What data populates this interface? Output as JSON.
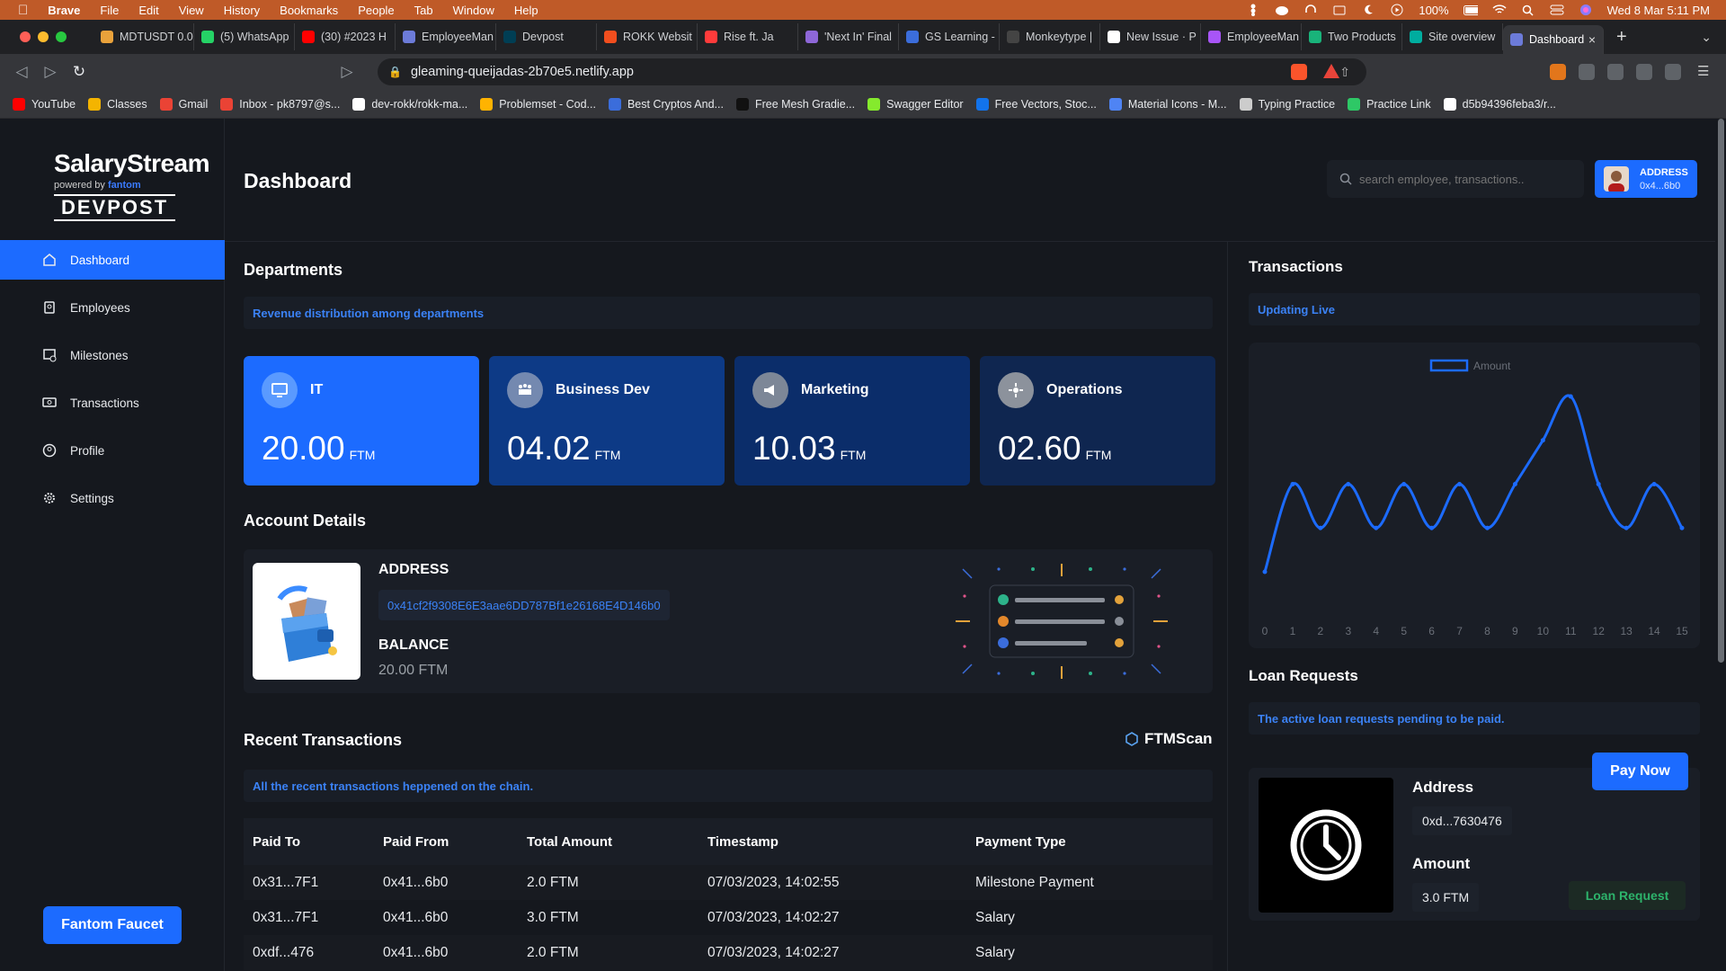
{
  "menubar": {
    "app": "Brave",
    "items": [
      "File",
      "Edit",
      "View",
      "History",
      "Bookmarks",
      "People",
      "Tab",
      "Window",
      "Help"
    ],
    "battery": "100%",
    "datetime": "Wed 8 Mar  5:11 PM"
  },
  "tabs": [
    {
      "label": "MDTUSDT 0.0",
      "color": "#e9a23b"
    },
    {
      "label": "(5) WhatsApp",
      "color": "#25d366"
    },
    {
      "label": "(30) #2023 H",
      "color": "#ff0000"
    },
    {
      "label": "EmployeeMan",
      "color": "#6c7bd9"
    },
    {
      "label": "Devpost",
      "color": "#003e54"
    },
    {
      "label": "ROKK Websit",
      "color": "#f24e1e"
    },
    {
      "label": "Rise ft. Ja",
      "color": "#ff3b3b"
    },
    {
      "label": "'Next In' Final",
      "color": "#8e67d8"
    },
    {
      "label": "GS Learning -",
      "color": "#3b6ddb"
    },
    {
      "label": "Monkeytype |",
      "color": "#444444"
    },
    {
      "label": "New Issue · P",
      "color": "#ffffff"
    },
    {
      "label": "EmployeeMan",
      "color": "#a855f7"
    },
    {
      "label": "Two Products",
      "color": "#19b37a"
    },
    {
      "label": "Site overview",
      "color": "#00ad9f"
    },
    {
      "label": "Dashboard",
      "color": "#6c7bd9",
      "active": true
    }
  ],
  "address_bar": {
    "url": "gleaming-queijadas-2b70e5.netlify.app"
  },
  "bookmarks": [
    {
      "label": "YouTube",
      "color": "#ff0000"
    },
    {
      "label": "Classes",
      "color": "#f4b400"
    },
    {
      "label": "Gmail",
      "color": "#ea4335"
    },
    {
      "label": "Inbox - pk8797@s...",
      "color": "#ea4335"
    },
    {
      "label": "dev-rokk/rokk-ma...",
      "color": "#ffffff"
    },
    {
      "label": "Problemset - Cod...",
      "color": "#ffb300"
    },
    {
      "label": "Best Cryptos And...",
      "color": "#3b6ddb"
    },
    {
      "label": "Free Mesh Gradie...",
      "color": "#111111"
    },
    {
      "label": "Swagger Editor",
      "color": "#85ea2d"
    },
    {
      "label": "Free Vectors, Stoc...",
      "color": "#1273eb"
    },
    {
      "label": "Material Icons - M...",
      "color": "#4f84f4"
    },
    {
      "label": "Typing Practice",
      "color": "#cccccc"
    },
    {
      "label": "Practice Link",
      "color": "#2ec866"
    },
    {
      "label": "d5b94396feba3/r...",
      "color": "#ffffff"
    }
  ],
  "brand": {
    "name": "SalaryStream",
    "powered": "powered by",
    "partner": "fantom",
    "sponsor": "DEVPOST"
  },
  "sidebar": {
    "items": [
      {
        "label": "Dashboard",
        "icon": "home-icon",
        "active": true
      },
      {
        "label": "Employees",
        "icon": "employees-icon"
      },
      {
        "label": "Milestones",
        "icon": "milestones-icon"
      },
      {
        "label": "Transactions",
        "icon": "transactions-icon"
      },
      {
        "label": "Profile",
        "icon": "profile-icon"
      },
      {
        "label": "Settings",
        "icon": "settings-icon"
      }
    ],
    "faucet_label": "Fantom Faucet"
  },
  "header": {
    "title": "Dashboard",
    "search_placeholder": "search employee, transactions..",
    "address_label": "ADDRESS",
    "address_short": "0x4...6b0"
  },
  "departments": {
    "title": "Departments",
    "subtitle": "Revenue distribution among departments",
    "unit": "FTM",
    "items": [
      {
        "name": "IT",
        "value": "20.00",
        "bg": "#1c6bff",
        "iconbg": "#5a9aff"
      },
      {
        "name": "Business Dev",
        "value": "04.02",
        "bg": "#0d3a86",
        "iconbg": "#7489b0"
      },
      {
        "name": "Marketing",
        "value": "10.03",
        "bg": "#0b2d6a",
        "iconbg": "#7d8797"
      },
      {
        "name": "Operations",
        "value": "02.60",
        "bg": "#0f2650",
        "iconbg": "#8c929c"
      }
    ]
  },
  "account": {
    "title": "Account Details",
    "address_label": "ADDRESS",
    "address": "0x41cf2f9308E6E3aae6DD787Bf1e26168E4D146b0",
    "balance_label": "BALANCE",
    "balance": "20.00 FTM"
  },
  "recent": {
    "title": "Recent Transactions",
    "scan_label": "FTMScan",
    "subtitle": "All the recent transactions heppened on the chain.",
    "columns": [
      "Paid To",
      "Paid From",
      "Total Amount",
      "Timestamp",
      "Payment Type"
    ],
    "rows": [
      [
        "0x31...7F1",
        "0x41...6b0",
        "2.0 FTM",
        "07/03/2023, 14:02:55",
        "Milestone Payment"
      ],
      [
        "0x31...7F1",
        "0x41...6b0",
        "3.0 FTM",
        "07/03/2023, 14:02:27",
        "Salary"
      ],
      [
        "0xdf...476",
        "0x41...6b0",
        "2.0 FTM",
        "07/03/2023, 14:02:27",
        "Salary"
      ]
    ]
  },
  "transactions": {
    "title": "Transactions",
    "subtitle": "Updating Live"
  },
  "chart_data": {
    "type": "line",
    "legend": "Amount",
    "legend_position": "top-center",
    "x": [
      0,
      1,
      2,
      3,
      4,
      5,
      6,
      7,
      8,
      9,
      10,
      11,
      12,
      13,
      14,
      15
    ],
    "series": [
      {
        "name": "Amount",
        "values": [
          1.0,
          3.0,
          2.0,
          3.0,
          2.0,
          3.0,
          2.0,
          3.0,
          2.0,
          3.0,
          4.0,
          5.0,
          3.0,
          2.0,
          3.0,
          2.0
        ]
      }
    ],
    "color": "#1c6bff",
    "grid": false
  },
  "loans": {
    "title": "Loan Requests",
    "subtitle": "The active loan requests pending to be paid.",
    "pay_label": "Pay Now",
    "address_label": "Address",
    "address": "0xd...7630476",
    "amount_label": "Amount",
    "amount": "3.0 FTM",
    "request_label": "Loan Request"
  }
}
